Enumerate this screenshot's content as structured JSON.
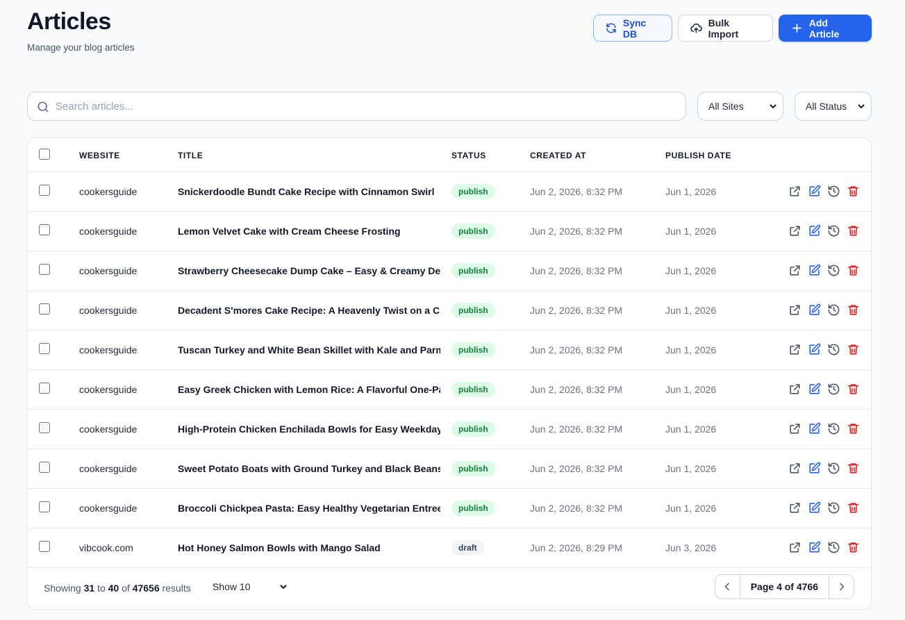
{
  "header": {
    "title": "Articles",
    "subtitle": "Manage your blog articles",
    "sync_label": "Sync DB",
    "import_label": "Bulk Import",
    "add_label": "Add Article"
  },
  "filters": {
    "search_placeholder": "Search articles...",
    "sites_value": "All Sites",
    "status_value": "All Status"
  },
  "table": {
    "columns": [
      "WEBSITE",
      "TITLE",
      "STATUS",
      "CREATED AT",
      "PUBLISH DATE"
    ],
    "rows": [
      {
        "website": "cookersguide",
        "title": "Snickerdoodle Bundt Cake Recipe with Cinnamon Swirl",
        "status": "publish",
        "created": "Jun 2, 2026, 8:32 PM",
        "publish": "Jun 1, 2026"
      },
      {
        "website": "cookersguide",
        "title": "Lemon Velvet Cake with Cream Cheese Frosting",
        "status": "publish",
        "created": "Jun 2, 2026, 8:32 PM",
        "publish": "Jun 1, 2026"
      },
      {
        "website": "cookersguide",
        "title": "Strawberry Cheesecake Dump Cake – Easy & Creamy Dessert",
        "status": "publish",
        "created": "Jun 2, 2026, 8:32 PM",
        "publish": "Jun 1, 2026"
      },
      {
        "website": "cookersguide",
        "title": "Decadent S'mores Cake Recipe: A Heavenly Twist on a Classic",
        "status": "publish",
        "created": "Jun 2, 2026, 8:32 PM",
        "publish": "Jun 1, 2026"
      },
      {
        "website": "cookersguide",
        "title": "Tuscan Turkey and White Bean Skillet with Kale and Parmesan",
        "status": "publish",
        "created": "Jun 2, 2026, 8:32 PM",
        "publish": "Jun 1, 2026"
      },
      {
        "website": "cookersguide",
        "title": "Easy Greek Chicken with Lemon Rice: A Flavorful One-Pan Supper",
        "status": "publish",
        "created": "Jun 2, 2026, 8:32 PM",
        "publish": "Jun 1, 2026"
      },
      {
        "website": "cookersguide",
        "title": "High-Protein Chicken Enchilada Bowls for Easy Weekday Meals",
        "status": "publish",
        "created": "Jun 2, 2026, 8:32 PM",
        "publish": "Jun 1, 2026"
      },
      {
        "website": "cookersguide",
        "title": "Sweet Potato Boats with Ground Turkey and Black Beans | Healthy",
        "status": "publish",
        "created": "Jun 2, 2026, 8:32 PM",
        "publish": "Jun 1, 2026"
      },
      {
        "website": "cookersguide",
        "title": "Broccoli Chickpea Pasta: Easy Healthy Vegetarian Entree Recipe",
        "status": "publish",
        "created": "Jun 2, 2026, 8:32 PM",
        "publish": "Jun 1, 2026"
      },
      {
        "website": "vibcook.com",
        "title": "Hot Honey Salmon Bowls with Mango Salad",
        "status": "draft",
        "created": "Jun 2, 2026, 8:29 PM",
        "publish": "Jun 3, 2026"
      }
    ]
  },
  "footer": {
    "showing_prefix": "Showing",
    "from": "31",
    "to_word": "to",
    "to": "40",
    "of_word": "of",
    "total": "47656",
    "results_word": "results",
    "page_size": "Show 10",
    "page_label": "Page 4 of 4766"
  },
  "icons": {
    "open": "external-link-icon",
    "edit": "edit-icon",
    "history": "history-icon",
    "delete": "trash-icon"
  },
  "colors": {
    "primary": "#2563eb",
    "publish_bg": "#dcfce7",
    "publish_text": "#15803d",
    "draft_bg": "#f1f5f9",
    "delete": "#dc2626",
    "edit": "#2563eb",
    "muted": "#6b7280"
  }
}
